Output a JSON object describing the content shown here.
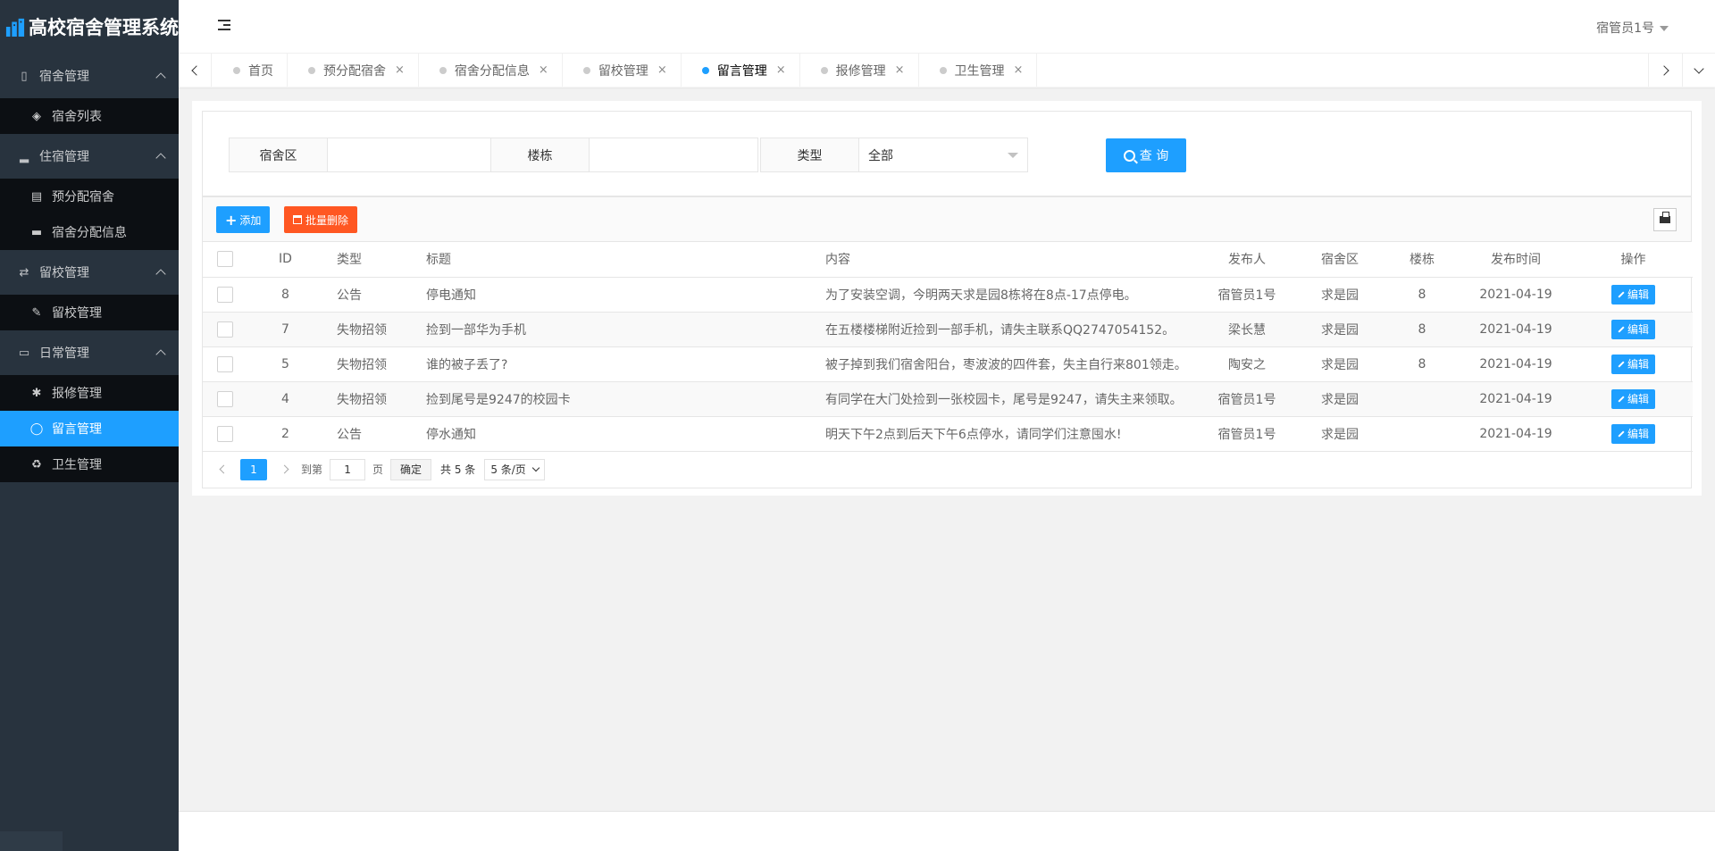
{
  "app": {
    "title": "高校宿舍管理系统",
    "accent": "#1E9FFF",
    "danger": "#FF5722",
    "sidebar_bg": "#28333e"
  },
  "header": {
    "user": "宿管员1号"
  },
  "sidebar": {
    "groups": [
      {
        "label": "宿舍管理",
        "icon": "building-icon",
        "items": [
          {
            "label": "宿舍列表",
            "icon": "cube-icon"
          }
        ]
      },
      {
        "label": "住宿管理",
        "icon": "signal-icon",
        "items": [
          {
            "label": "预分配宿舍",
            "icon": "id-card-icon"
          },
          {
            "label": "宿舍分配信息",
            "icon": "bed-icon"
          }
        ]
      },
      {
        "label": "留校管理",
        "icon": "exchange-icon",
        "items": [
          {
            "label": "留校管理",
            "icon": "edit-icon"
          }
        ]
      },
      {
        "label": "日常管理",
        "icon": "laptop-icon",
        "items": [
          {
            "label": "报修管理",
            "icon": "gear-icon"
          },
          {
            "label": "留言管理",
            "icon": "comment-icon",
            "active": true
          },
          {
            "label": "卫生管理",
            "icon": "recycle-icon"
          }
        ]
      }
    ]
  },
  "tabs": [
    {
      "label": "首页",
      "closable": false
    },
    {
      "label": "预分配宿舍",
      "closable": true
    },
    {
      "label": "宿舍分配信息",
      "closable": true
    },
    {
      "label": "留校管理",
      "closable": true
    },
    {
      "label": "留言管理",
      "closable": true,
      "active": true
    },
    {
      "label": "报修管理",
      "closable": true
    },
    {
      "label": "卫生管理",
      "closable": true
    }
  ],
  "search": {
    "area_label": "宿舍区",
    "area_value": "",
    "building_label": "楼栋",
    "building_value": "",
    "type_label": "类型",
    "type_value": "全部",
    "query_button": "查 询"
  },
  "toolbar": {
    "add_label": "添加",
    "batch_delete_label": "批量删除"
  },
  "table": {
    "columns": [
      "ID",
      "类型",
      "标题",
      "内容",
      "发布人",
      "宿舍区",
      "楼栋",
      "发布时间",
      "操作"
    ],
    "edit_label": "编辑",
    "rows": [
      {
        "id": "8",
        "type": "公告",
        "title": "停电通知",
        "content": "为了安装空调，今明两天求是园8栋将在8点-17点停电。",
        "publisher": "宿管员1号",
        "area": "求是园",
        "building": "8",
        "time": "2021-04-19"
      },
      {
        "id": "7",
        "type": "失物招领",
        "title": "捡到一部华为手机",
        "content": "在五楼楼梯附近捡到一部手机，请失主联系QQ2747054152。",
        "publisher": "梁长慧",
        "area": "求是园",
        "building": "8",
        "time": "2021-04-19"
      },
      {
        "id": "5",
        "type": "失物招领",
        "title": "谁的被子丢了?",
        "content": "被子掉到我们宿舍阳台，枣波波的四件套，失主自行来801领走。",
        "publisher": "陶安之",
        "area": "求是园",
        "building": "8",
        "time": "2021-04-19"
      },
      {
        "id": "4",
        "type": "失物招领",
        "title": "捡到尾号是9247的校园卡",
        "content": "有同学在大门处捡到一张校园卡，尾号是9247，请失主来领取。",
        "publisher": "宿管员1号",
        "area": "求是园",
        "building": "",
        "time": "2021-04-19"
      },
      {
        "id": "2",
        "type": "公告",
        "title": "停水通知",
        "content": "明天下午2点到后天下午6点停水，请同学们注意囤水!",
        "publisher": "宿管员1号",
        "area": "求是园",
        "building": "",
        "time": "2021-04-19"
      }
    ]
  },
  "pager": {
    "current": "1",
    "goto_label": "到第",
    "goto_value": "1",
    "page_label": "页",
    "confirm_label": "确定",
    "total_label": "共 5 条",
    "limit_label": "5 条/页"
  }
}
